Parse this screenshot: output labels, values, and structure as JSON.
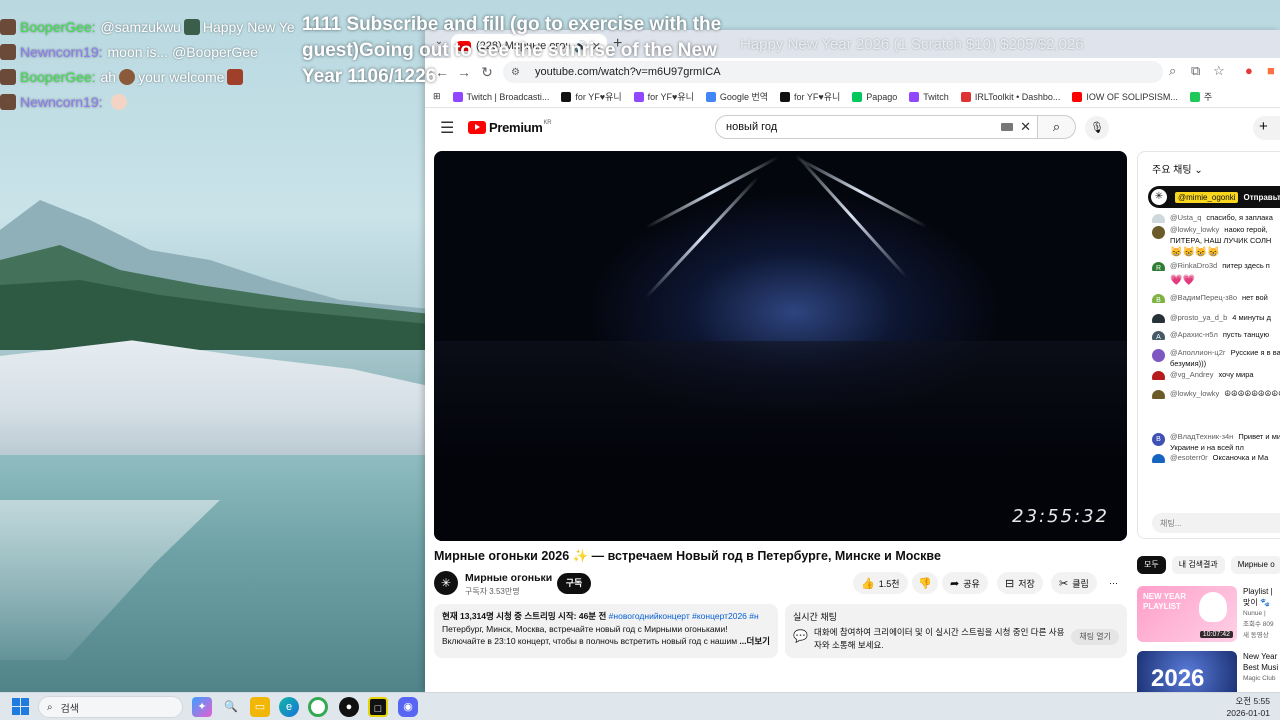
{
  "overlay": {
    "chat": [
      {
        "user": "BooperGee:",
        "user_color": "#3ee04a",
        "text": "@samzukwu",
        "tail": "Happy New Ye"
      },
      {
        "user": "Newncorn19:",
        "user_color": "#9a7cf0",
        "text": "moon is... @BooperGee",
        "tail": ""
      },
      {
        "user": "BooperGee:",
        "user_color": "#3ee04a",
        "text": "ah",
        "tail": "your welcome"
      },
      {
        "user": "Newncorn19:",
        "user_color": "#9a7cf0",
        "text": "",
        "tail": ""
      }
    ],
    "title": "1111 Subscribe and fill (go to exercise with the guest)Going out to see the sunrise of the New Year 1106/1226",
    "goal": "Happy New Year 2026 (1 Scratch $10) $205/$2,026"
  },
  "browser": {
    "tab_title": "(228) Мирные огоньки 2",
    "url": "youtube.com/watch?v=m6U97grmICA",
    "bookmarks": [
      {
        "label": "Twitch | Broadcasti...",
        "color": "#9146ff"
      },
      {
        "label": "for YF♥유니",
        "color": "#111111"
      },
      {
        "label": "for YF♥유니",
        "color": "#9146ff"
      },
      {
        "label": "Google 번역",
        "color": "#4285f4"
      },
      {
        "label": "for YF♥유니",
        "color": "#111111"
      },
      {
        "label": "Papago",
        "color": "#03c75a"
      },
      {
        "label": "Twitch",
        "color": "#9146ff"
      },
      {
        "label": "IRLToolkit • Dashbo...",
        "color": "#d33"
      },
      {
        "label": "IOW OF SOLIPSISM...",
        "color": "#ff0000"
      },
      {
        "label": "주",
        "color": "#1ec95a"
      }
    ]
  },
  "youtube": {
    "logo": "Premium",
    "logo_region": "KR",
    "search_value": "новый год",
    "player_time": "23:55:32",
    "video_title": "Мирные огоньки 2026 ✨ — встречаем Новый год в Петербурге, Минске и Москве",
    "channel": {
      "name": "Мирные огоньки",
      "subs": "구독자 3.53만명",
      "subscribe": "구독"
    },
    "actions": {
      "like": "1.5천",
      "share": "공유",
      "save": "저장",
      "clip": "클립"
    },
    "description": {
      "stats": "현재 13,314명 시청 중  스트리밍 시작: 46분 전",
      "tags": "#новогоднийконцерт #концерт2026 #н",
      "line2": "Петербург, Минск, Москва, встречайте новый год с Мирными огоньками!",
      "line3": "Включайте в 23:10 концерт, чтобы в полночь встретить новый год с нашим",
      "more": "...더보기"
    },
    "livechat_box": {
      "title": "실시간 채팅",
      "text": "대화에 참여하여 크리에이터 및 이 실시간 스트림을 시청 중인 다른 사용자와 소통해 보세요.",
      "open": "채팅 열기"
    },
    "chat": {
      "header": "주요 채팅",
      "pinned_user": "@mimie_ogonki",
      "pinned_text": "Отправьте",
      "messages": [
        {
          "user": "@Usta_q",
          "text": "спасибо, я заплака",
          "color": "#cfd8dc",
          "initial": ""
        },
        {
          "user": "@lowky_lowky",
          "text": "наоко герой, ПИТЕРА, НАШ ЛУЧИК СОЛН",
          "color": "#6b5a2a",
          "initial": ""
        },
        {
          "user": "",
          "text": "😸😸😸😸",
          "color": "",
          "initial": ""
        },
        {
          "user": "@RinkaDro3d",
          "text": "питер здесь п",
          "color": "#2e7d32",
          "initial": "R"
        },
        {
          "user": "",
          "text": "💗💗",
          "color": "",
          "initial": ""
        },
        {
          "user": "@ВадимПерец-з8о",
          "text": "нет вой",
          "color": "#7cb342",
          "initial": "B"
        },
        {
          "user": "@prosto_ya_d_b",
          "text": "4 минуты д",
          "color": "#263238",
          "initial": ""
        },
        {
          "user": "@Арахис-н5л",
          "text": "пусть танцую",
          "color": "#455a64",
          "initial": "A"
        },
        {
          "user": "@Аполлион-ц2г",
          "text": "Русские я в вашего безумия)))",
          "color": "#7e57c2",
          "initial": ""
        },
        {
          "user": "@vg_Andrey",
          "text": "хочу мира",
          "color": "#b71c1c",
          "initial": ""
        },
        {
          "user": "@lowky_lowky",
          "text": "☮☮☮☮☮☮☮☮☮☮☮☮☮☮",
          "color": "#6b5a2a",
          "initial": ""
        },
        {
          "user": "@ВладТехник-з4н",
          "text": "Привет и мир на Украине и на всей пл",
          "color": "#3f51b5",
          "initial": "B"
        },
        {
          "user": "@esoterr0r",
          "text": "Оксаночка и Ма",
          "color": "#1565c0",
          "initial": ""
        }
      ],
      "input_placeholder": "채팅..."
    },
    "chips": [
      "모두",
      "내 검색결과",
      "Мирные о"
    ],
    "recs": [
      {
        "title": "Playlist |",
        "line2": "맞이 🐾",
        "channel": "Nunue | ",
        "views": "조회수 809",
        "badge": "새 동영상",
        "duration": "10:07:42",
        "thumb_text": "NEW YEAR PLAYLIST"
      },
      {
        "title": "New Year",
        "line2": "Best Musi",
        "channel": "Magic Club",
        "views": "",
        "badge": "",
        "duration": "",
        "thumb_text": "2026"
      }
    ]
  },
  "taskbar": {
    "search_placeholder": "검색",
    "time": "오전 5:55",
    "date": "2026-01-01"
  }
}
